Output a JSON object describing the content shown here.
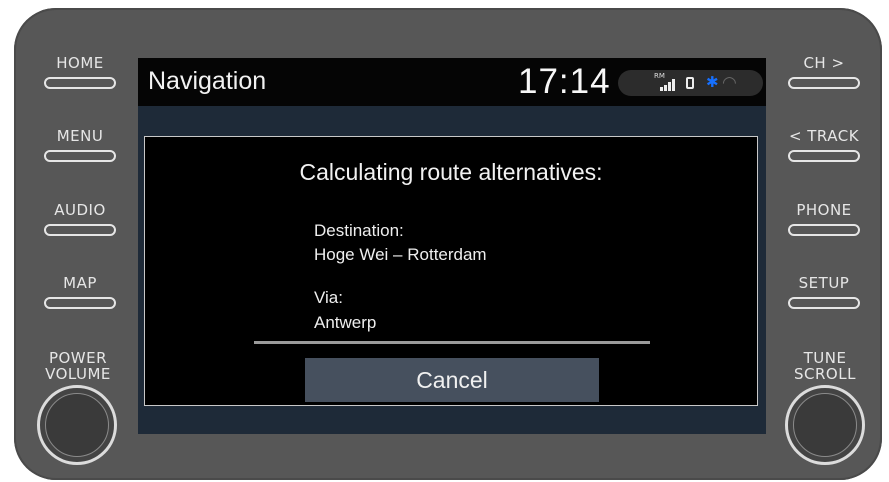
{
  "hardware": {
    "left_buttons": [
      "HOME",
      "MENU",
      "AUDIO",
      "MAP"
    ],
    "right_buttons": [
      "CH >",
      "< TRACK",
      "PHONE",
      "SETUP"
    ],
    "left_knob_label": [
      "POWER",
      "VOLUME"
    ],
    "right_knob_label": [
      "TUNE",
      "SCROLL"
    ]
  },
  "screen": {
    "title": "Navigation",
    "clock": "17:14",
    "status": {
      "signal_badge": "RM",
      "icons": [
        "signal-bars-icon",
        "phone-icon",
        "bluetooth-icon",
        "wifi-icon"
      ],
      "bluetooth_color": "#1670ff"
    }
  },
  "dialog": {
    "title": "Calculating route alternatives:",
    "destination_label": "Destination:",
    "destination_value": "Hoge Wei – Rotterdam",
    "via_label": "Via:",
    "via_value": "Antwerp",
    "progress": 1.0,
    "cancel_label": "Cancel"
  }
}
